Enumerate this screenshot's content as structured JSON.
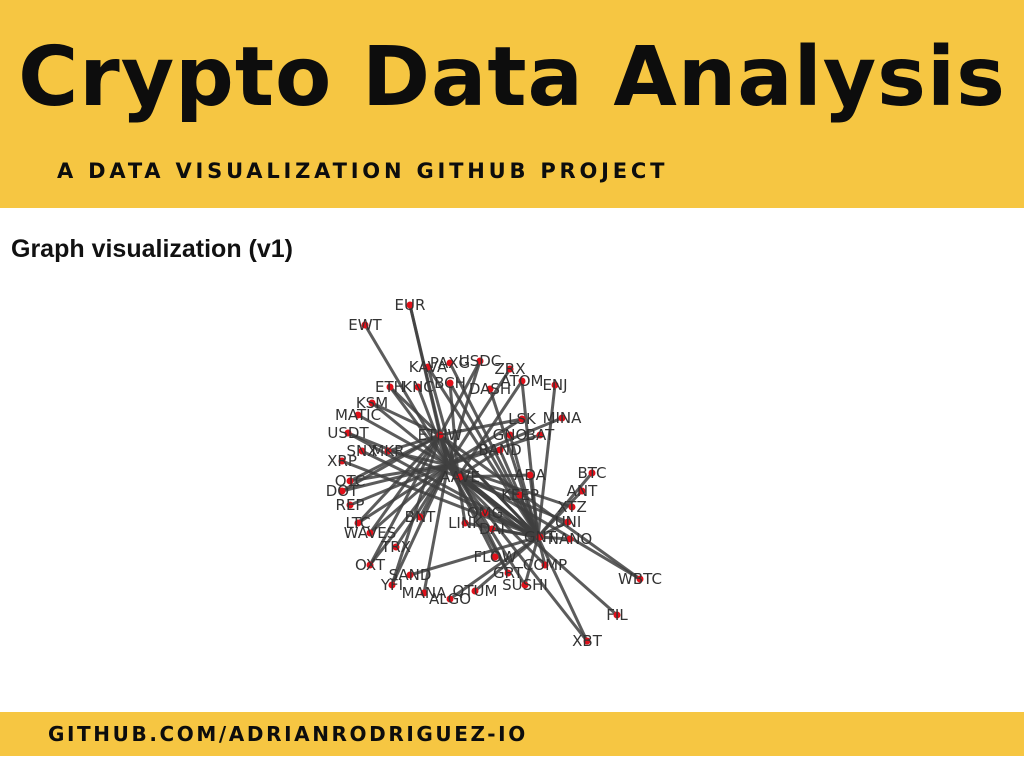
{
  "header": {
    "title": "Crypto Data Analysis",
    "subtitle": "A DATA VISUALIZATION GITHUB PROJECT"
  },
  "section": {
    "title": "Graph visualization (v1)"
  },
  "footer": {
    "link_text": "GITHUB.COM/ADRIANRODRIGUEZ-IO"
  },
  "colors": {
    "accent": "#f6c642",
    "node": "#e0101a",
    "edge": "#404040",
    "label": "#333333"
  },
  "graph": {
    "hubs": [
      "ETHW",
      "PAXG",
      "AAVE",
      "GNT"
    ],
    "nodes": [
      "EUR",
      "EWT",
      "KAVA",
      "PAXG",
      "USDC",
      "ZRX",
      "ATOM",
      "ENJ",
      "ETH",
      "KNC",
      "BCH",
      "DASH",
      "KSM",
      "MATIC",
      "ETHW",
      "GNO",
      "LSK",
      "MINA",
      "USDT",
      "SNX",
      "MKR",
      "BAT",
      "BAND",
      "XRP",
      "OTC",
      "AAVE",
      "ADA",
      "BTC",
      "DOT",
      "REP",
      "KEEP",
      "ANT",
      "LTC",
      "BNT",
      "LINK",
      "OMG",
      "WAVES",
      "XTZ",
      "GNT",
      "NANO",
      "OXT",
      "FLOW",
      "COMP",
      "SAND",
      "YFI",
      "MANA",
      "SUSHI",
      "QTUM",
      "WBTC",
      "FIL",
      "XBT",
      "ALGO",
      "GRT",
      "TRX",
      "UNI",
      "DAI"
    ]
  }
}
